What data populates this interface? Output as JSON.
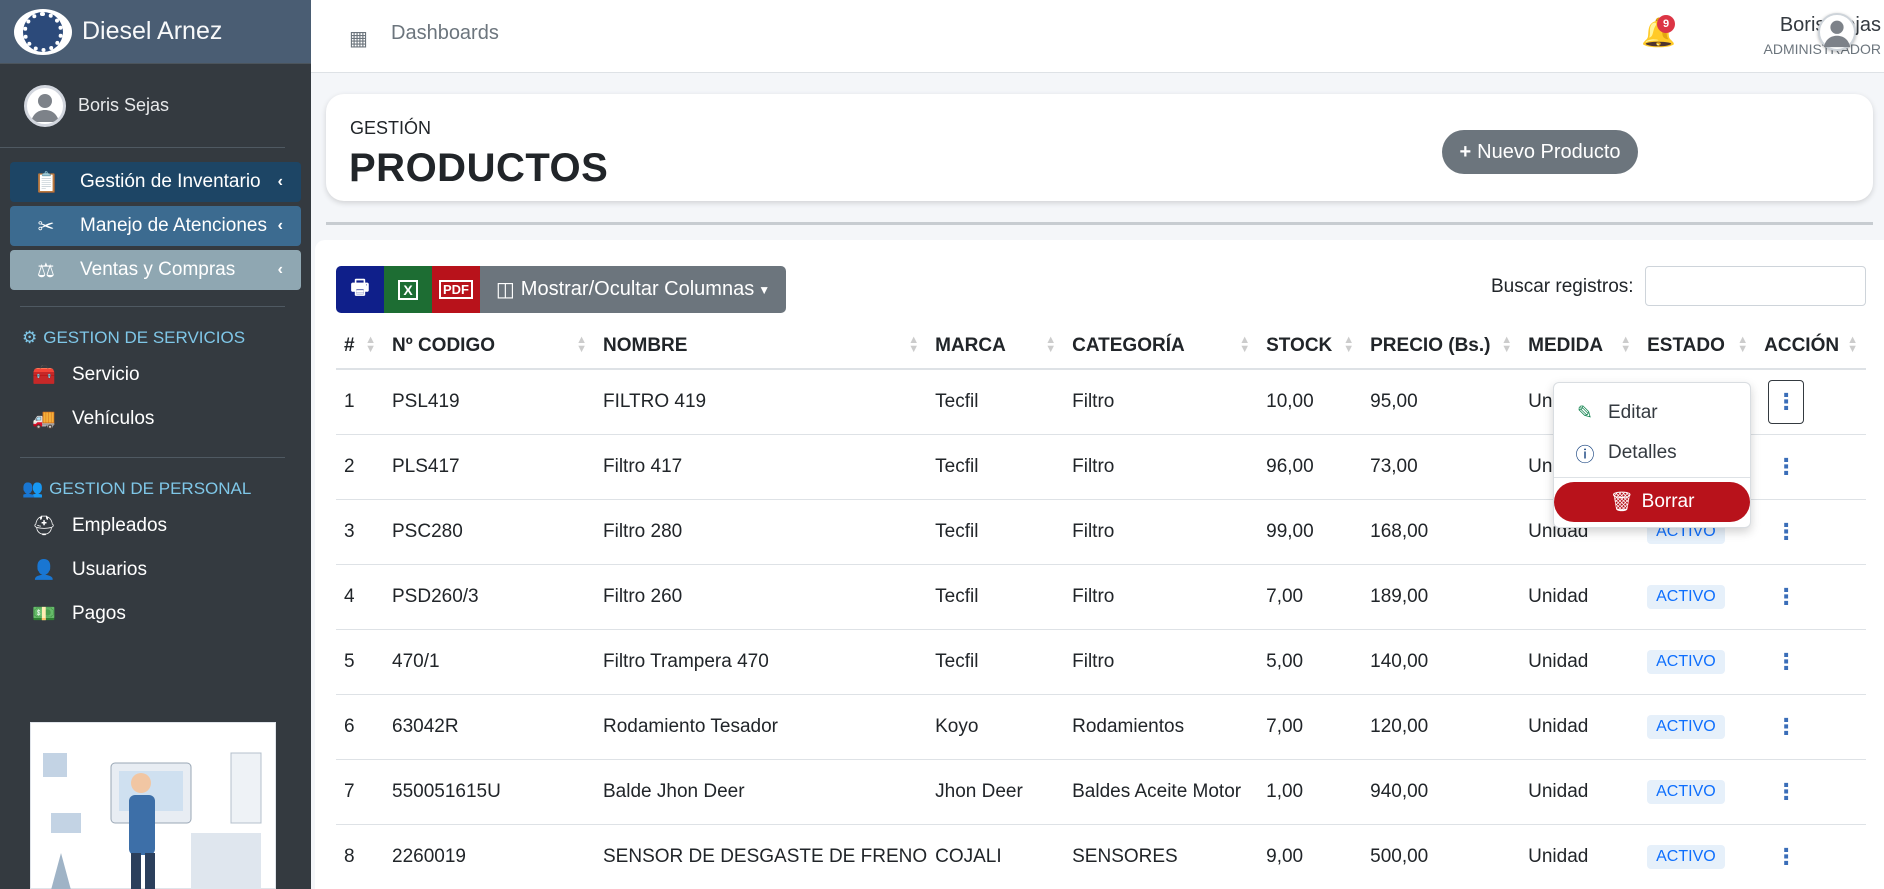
{
  "brand": {
    "name": "Diesel Arnez"
  },
  "sidebar": {
    "user": "Boris Sejas",
    "menus": [
      {
        "label": "Gestión de Inventario",
        "icon": "clipboard-icon"
      },
      {
        "label": "Manejo de Atenciones",
        "icon": "tools-icon"
      },
      {
        "label": "Ventas y Compras",
        "icon": "scale-icon"
      }
    ],
    "section1": {
      "title": "GESTION DE SERVICIOS",
      "items": [
        {
          "label": "Servicio",
          "icon": "toolbox-icon"
        },
        {
          "label": "Vehículos",
          "icon": "truck-icon"
        }
      ]
    },
    "section2": {
      "title": "GESTION DE PERSONAL",
      "items": [
        {
          "label": "Empleados",
          "icon": "hardhat-icon"
        },
        {
          "label": "Usuarios",
          "icon": "user-icon"
        },
        {
          "label": "Pagos",
          "icon": "money-icon"
        }
      ]
    }
  },
  "topbar": {
    "breadcrumb": "Dashboards",
    "notifications": "9",
    "user_name": "Boris Sejas",
    "user_role": "ADMINISTRADOR"
  },
  "header": {
    "subtitle": "GESTIÓN",
    "title": "PRODUCTOS",
    "new_button": "Nuevo Producto"
  },
  "toolbar": {
    "columns_button": "Mostrar/Ocultar Columnas",
    "search_label": "Buscar registros:"
  },
  "table": {
    "headers": [
      "#",
      "Nº CODIGO",
      "NOMBRE",
      "MARCA",
      "CATEGORÍA",
      "STOCK",
      "PRECIO (Bs.)",
      "MEDIDA",
      "ESTADO",
      "ACCIÓN"
    ],
    "rows": [
      [
        "1",
        "PSL419",
        "FILTRO 419",
        "Tecfil",
        "Filtro",
        "10,00",
        "95,00",
        "Unid",
        ""
      ],
      [
        "2",
        "PLS417",
        "Filtro 417",
        "Tecfil",
        "Filtro",
        "96,00",
        "73,00",
        "Unid",
        ""
      ],
      [
        "3",
        "PSC280",
        "Filtro 280",
        "Tecfil",
        "Filtro",
        "99,00",
        "168,00",
        "Unidad",
        "ACTIVO"
      ],
      [
        "4",
        "PSD260/3",
        "Filtro 260",
        "Tecfil",
        "Filtro",
        "7,00",
        "189,00",
        "Unidad",
        "ACTIVO"
      ],
      [
        "5",
        "470/1",
        "Filtro Trampera 470",
        "Tecfil",
        "Filtro",
        "5,00",
        "140,00",
        "Unidad",
        "ACTIVO"
      ],
      [
        "6",
        "63042R",
        "Rodamiento Tesador",
        "Koyo",
        "Rodamientos",
        "7,00",
        "120,00",
        "Unidad",
        "ACTIVO"
      ],
      [
        "7",
        "550051615U",
        "Balde Jhon Deer",
        "Jhon Deer",
        "Baldes Aceite Motor",
        "1,00",
        "940,00",
        "Unidad",
        "ACTIVO"
      ],
      [
        "8",
        "2260019",
        "SENSOR DE DESGASTE DE FRENO",
        "COJALI",
        "SENSORES",
        "9,00",
        "500,00",
        "Unidad",
        "ACTIVO"
      ]
    ]
  },
  "dropdown": {
    "edit": "Editar",
    "details": "Detalles",
    "delete": "Borrar"
  }
}
